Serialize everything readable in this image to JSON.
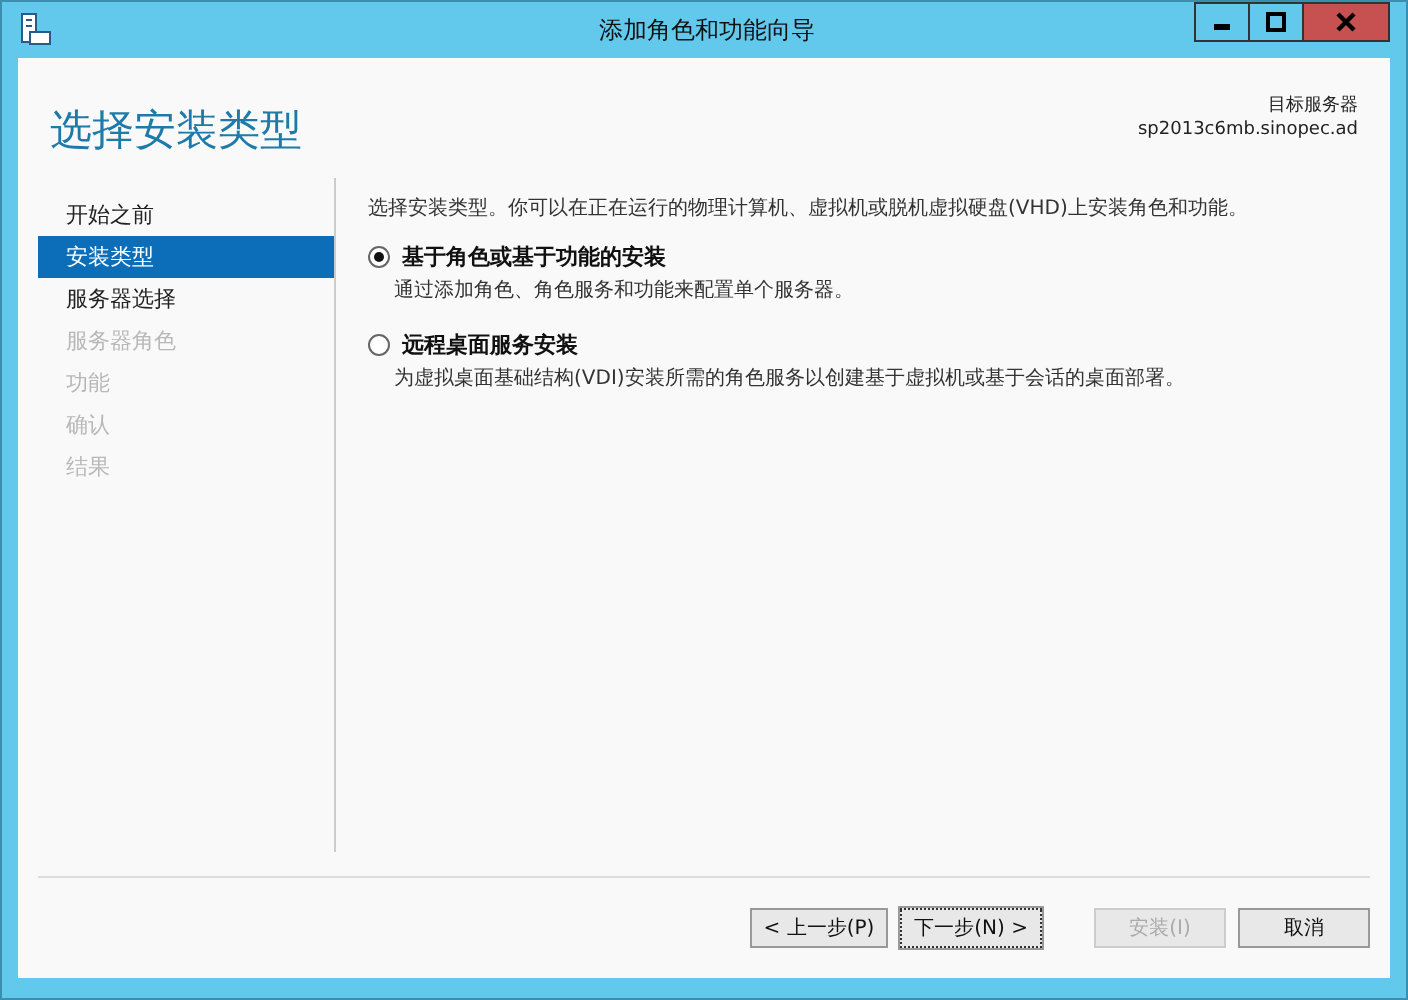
{
  "window": {
    "title": "添加角色和功能向导"
  },
  "header": {
    "title": "选择安装类型",
    "target_label": "目标服务器",
    "target_server": "sp2013c6mb.sinopec.ad"
  },
  "sidebar": {
    "items": [
      {
        "label": "开始之前",
        "selected": false,
        "disabled": false
      },
      {
        "label": "安装类型",
        "selected": true,
        "disabled": false
      },
      {
        "label": "服务器选择",
        "selected": false,
        "disabled": false
      },
      {
        "label": "服务器角色",
        "selected": false,
        "disabled": true
      },
      {
        "label": "功能",
        "selected": false,
        "disabled": true
      },
      {
        "label": "确认",
        "selected": false,
        "disabled": true
      },
      {
        "label": "结果",
        "selected": false,
        "disabled": true
      }
    ]
  },
  "intro": "选择安装类型。你可以在正在运行的物理计算机、虚拟机或脱机虚拟硬盘(VHD)上安装角色和功能。",
  "options": [
    {
      "label": "基于角色或基于功能的安装",
      "description": "通过添加角色、角色服务和功能来配置单个服务器。",
      "selected": true
    },
    {
      "label": "远程桌面服务安装",
      "description": "为虚拟桌面基础结构(VDI)安装所需的角色服务以创建基于虚拟机或基于会话的桌面部署。",
      "selected": false
    }
  ],
  "buttons": [
    {
      "label": "< 上一步(P)",
      "disabled": false,
      "focused": false
    },
    {
      "label": "下一步(N) >",
      "disabled": false,
      "focused": true
    },
    {
      "label": "安装(I)",
      "disabled": true,
      "focused": false
    },
    {
      "label": "取消",
      "disabled": false,
      "focused": false
    }
  ]
}
